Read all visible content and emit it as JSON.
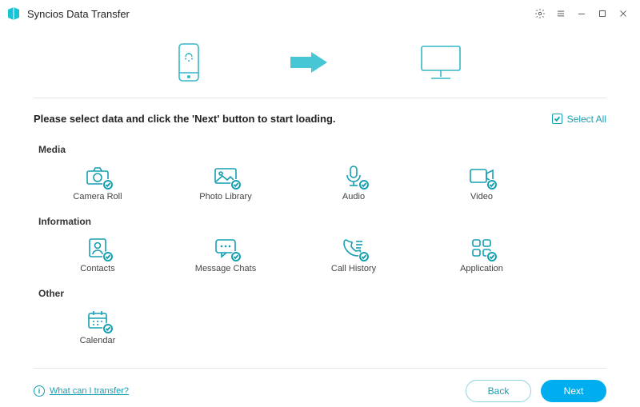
{
  "app": {
    "title": "Syncios Data Transfer"
  },
  "header": {
    "instruction": "Please select data and click the 'Next' button to start loading.",
    "select_all": "Select All"
  },
  "sections": {
    "media": {
      "title": "Media",
      "items": [
        {
          "id": "camera-roll",
          "label": "Camera Roll"
        },
        {
          "id": "photo-library",
          "label": "Photo Library"
        },
        {
          "id": "audio",
          "label": "Audio"
        },
        {
          "id": "video",
          "label": "Video"
        }
      ]
    },
    "information": {
      "title": "Information",
      "items": [
        {
          "id": "contacts",
          "label": "Contacts"
        },
        {
          "id": "message-chats",
          "label": "Message Chats"
        },
        {
          "id": "call-history",
          "label": "Call History"
        },
        {
          "id": "application",
          "label": "Application"
        }
      ]
    },
    "other": {
      "title": "Other",
      "items": [
        {
          "id": "calendar",
          "label": "Calendar"
        }
      ]
    }
  },
  "footer": {
    "help": "What can I transfer?",
    "back": "Back",
    "next": "Next"
  }
}
